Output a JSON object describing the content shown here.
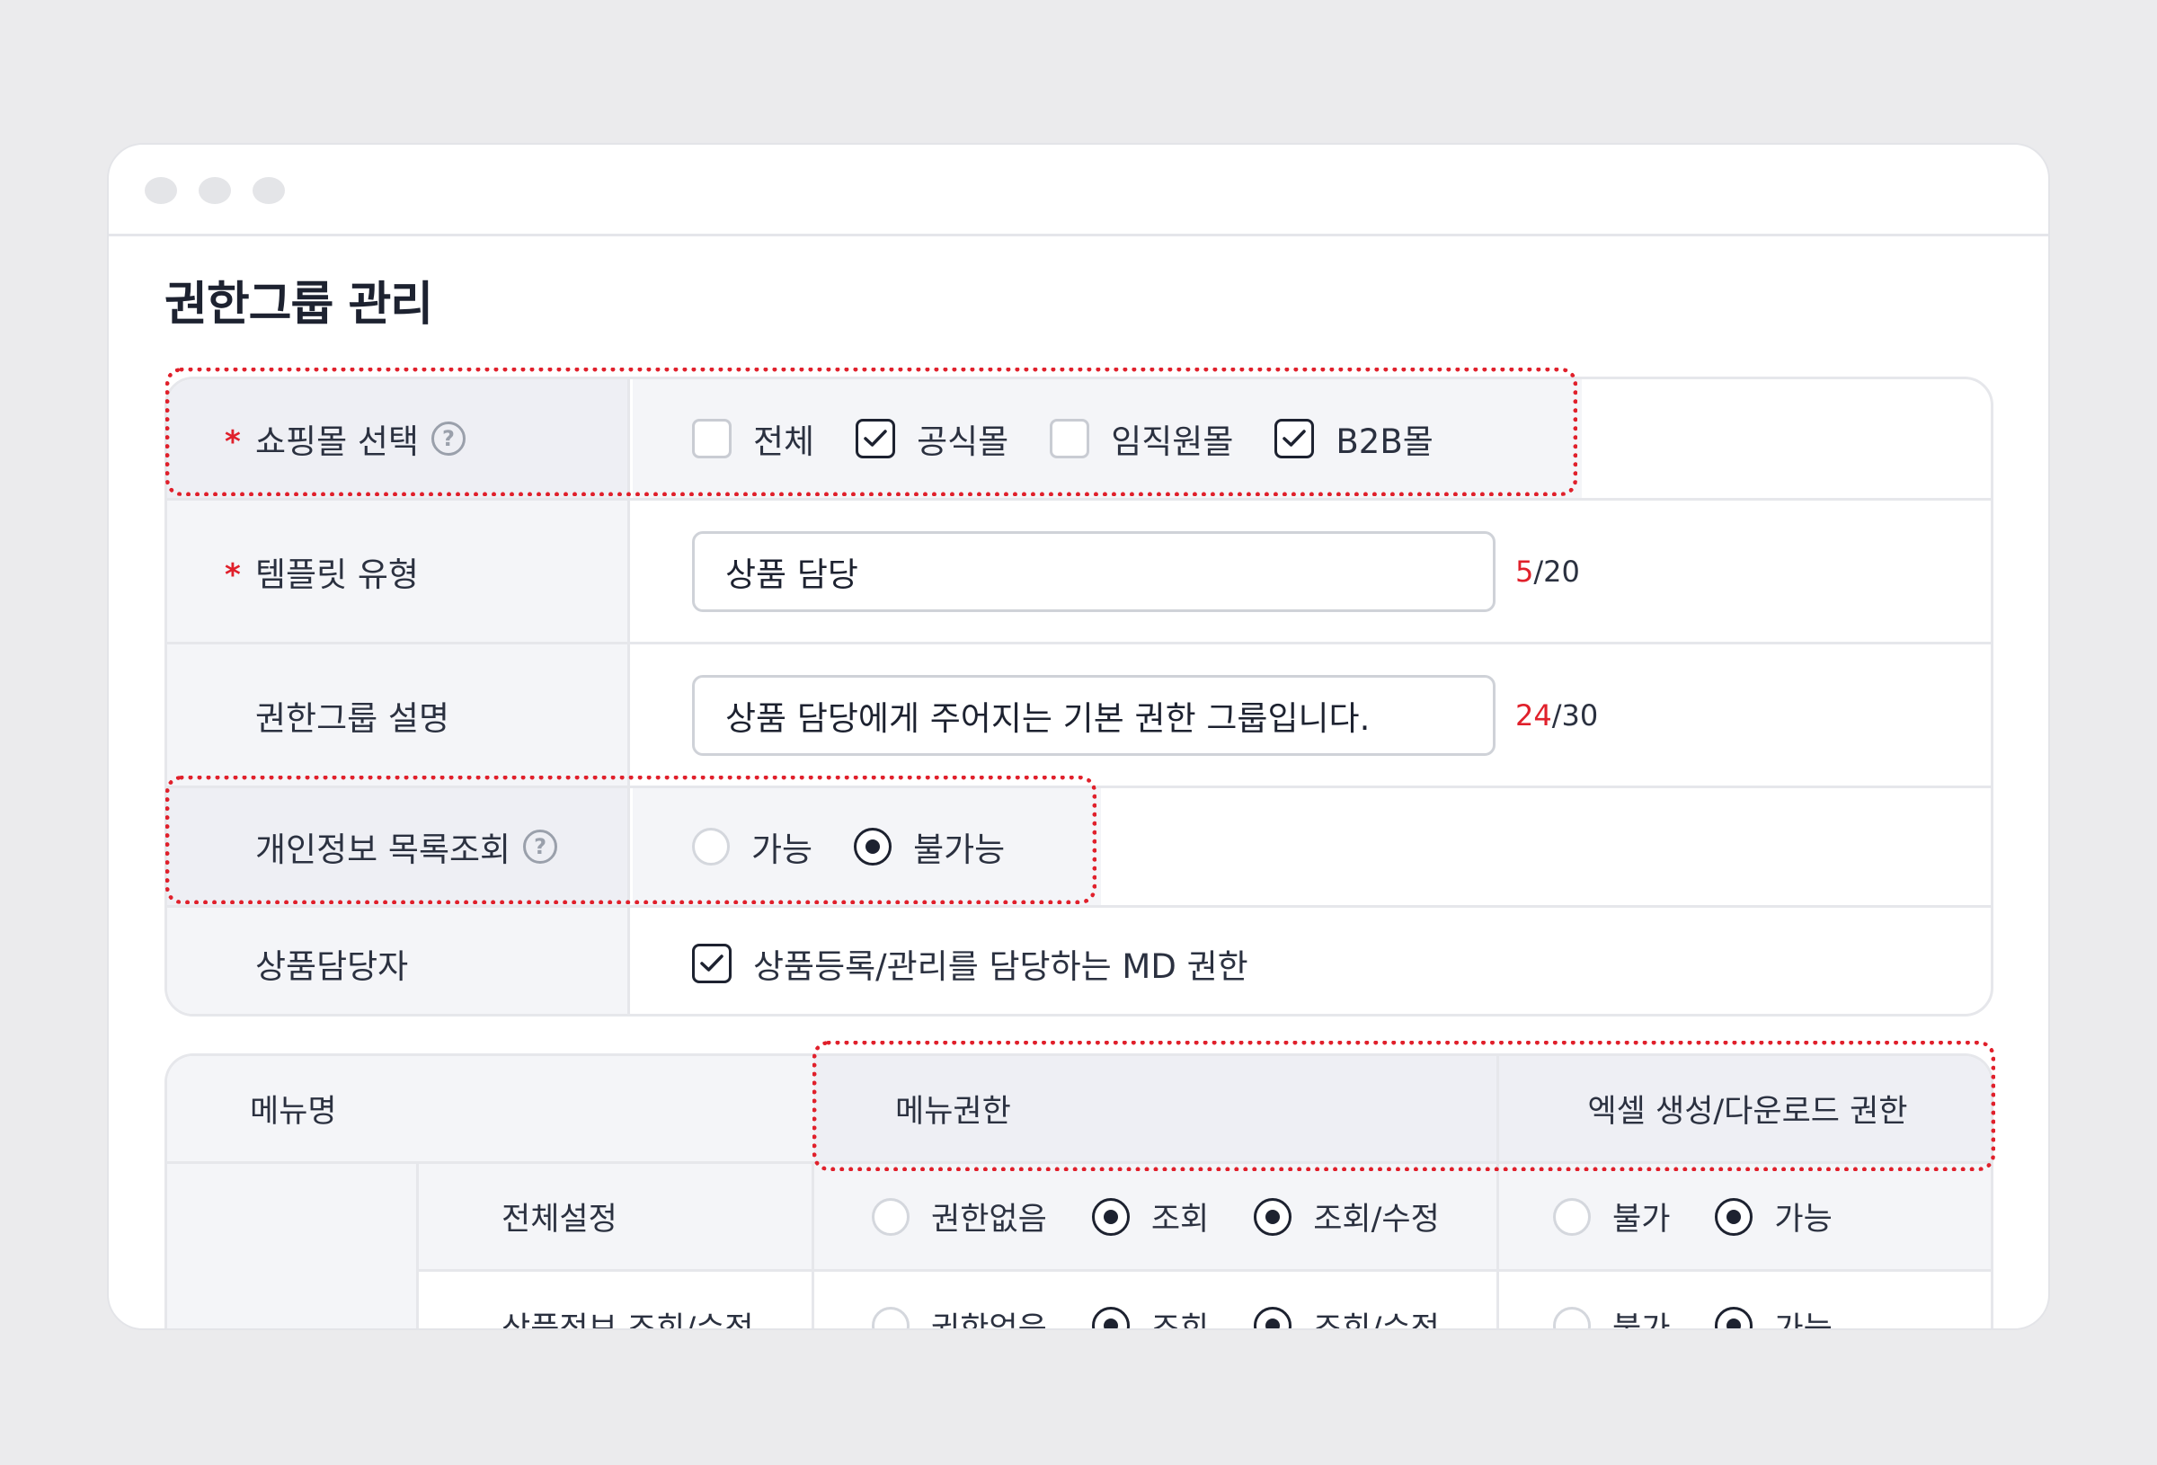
{
  "page": {
    "title": "권한그룹 관리"
  },
  "form": {
    "mall": {
      "label": "쇼핑몰 선택",
      "required_mark": "*",
      "help_icon": "?",
      "options": [
        {
          "label": "전체",
          "checked": false
        },
        {
          "label": "공식몰",
          "checked": true
        },
        {
          "label": "임직원몰",
          "checked": false
        },
        {
          "label": "B2B몰",
          "checked": true
        }
      ]
    },
    "template": {
      "label": "템플릿 유형",
      "required_mark": "*",
      "value": "상품 담당",
      "count_current": "5",
      "count_max": "/20"
    },
    "description": {
      "label": "권한그룹 설명",
      "value": "상품 담당에게 주어지는 기본 권한 그룹입니다.",
      "count_current": "24",
      "count_max": "/30"
    },
    "privacy": {
      "label": "개인정보 목록조회",
      "help_icon": "?",
      "options": [
        {
          "label": "가능",
          "selected": false
        },
        {
          "label": "불가능",
          "selected": true
        }
      ]
    },
    "manager": {
      "label": "상품담당자",
      "checkbox_label": "상품등록/관리를 담당하는 MD 권한",
      "checked": true
    }
  },
  "permissions": {
    "headers": {
      "menu": "메뉴명",
      "menu_perm": "메뉴권한",
      "excel_perm": "엑셀 생성/다운로드 권한"
    },
    "rows": [
      {
        "name": "전체설정",
        "menu_options": [
          "권한없음",
          "조회",
          "조회/수정"
        ],
        "menu_selected": [
          false,
          true,
          true
        ],
        "excel_options": [
          "불가",
          "가능"
        ],
        "excel_selected": [
          false,
          true
        ]
      },
      {
        "name": "상품정보 조회/수정",
        "menu_options": [
          "권한없음",
          "조회",
          "조회/수정"
        ],
        "menu_selected": [
          false,
          true,
          true
        ],
        "excel_options": [
          "불가",
          "가능"
        ],
        "excel_selected": [
          false,
          true
        ]
      }
    ]
  },
  "colors": {
    "accent_red": "#e0202b",
    "dark": "#1d2230",
    "label_bg": "#f4f5f8"
  },
  "icons": {
    "check": "check-icon",
    "help": "help-circle-icon",
    "radio": "radio-dot-icon"
  }
}
